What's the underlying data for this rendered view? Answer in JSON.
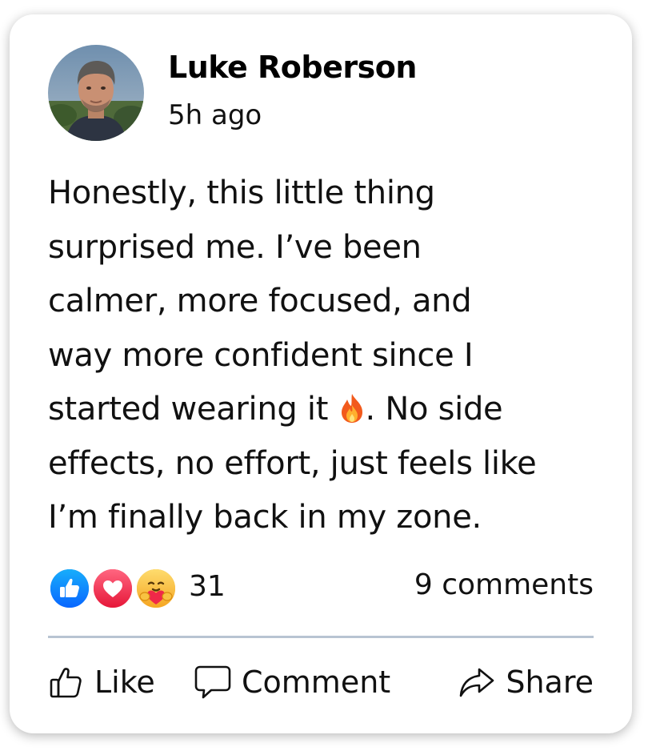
{
  "post": {
    "author": "Luke Roberson",
    "timestamp": "5h ago",
    "body_lines": [
      "Honestly, this little thing",
      "surprised me. I’ve been",
      "calmer, more focused, and",
      "way more confident since I",
      "started wearing it ",
      ". No side",
      "effects, no effort, just feels like",
      "I’m finally back in my zone."
    ],
    "emoji_inline": "fire-icon"
  },
  "stats": {
    "reaction_icons": [
      "like-reaction-icon",
      "love-reaction-icon",
      "care-reaction-icon"
    ],
    "reaction_count": "31",
    "comments": "9 comments"
  },
  "actions": {
    "like": "Like",
    "comment": "Comment",
    "share": "Share"
  },
  "colors": {
    "like_blue": "#1877f2",
    "love_red": "#f33e58",
    "care_yellow": "#f7b125",
    "divider": "#b8c4d2"
  }
}
